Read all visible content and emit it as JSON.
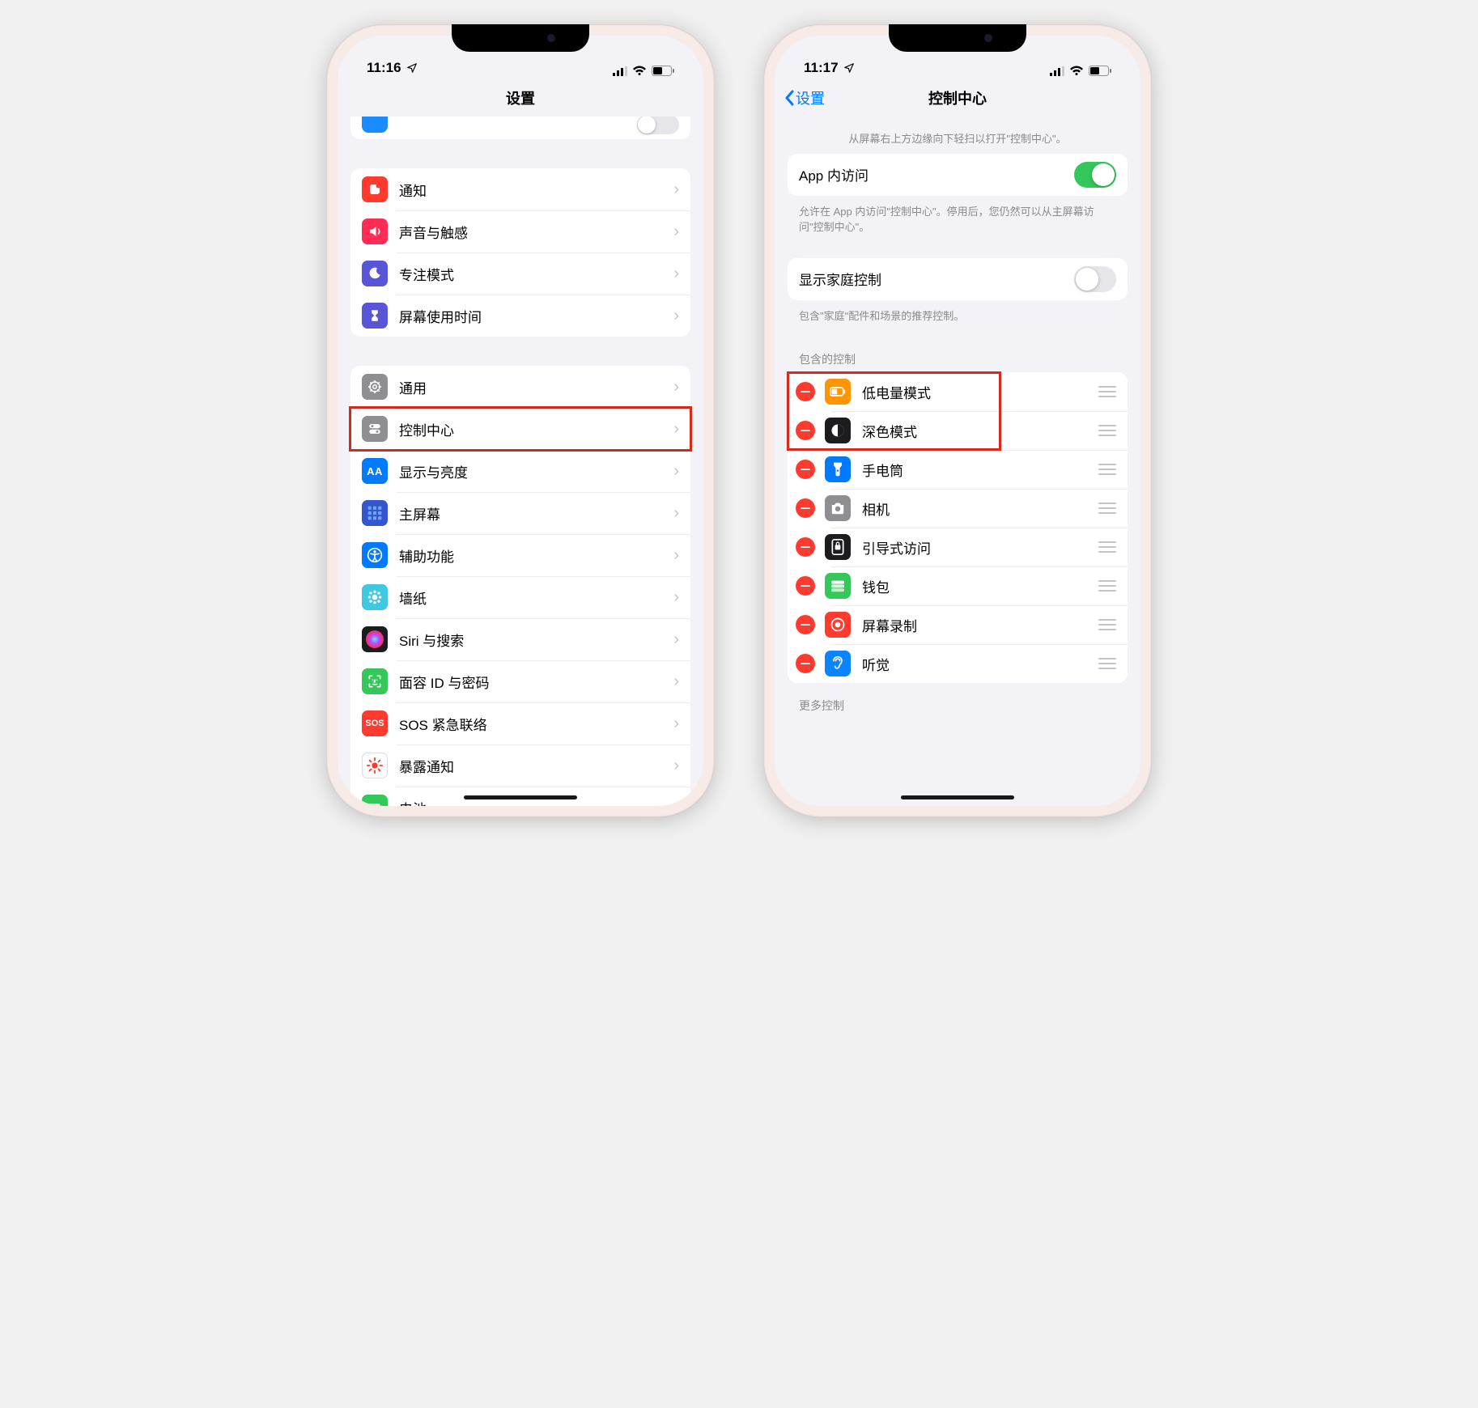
{
  "left": {
    "status": {
      "time": "11:16"
    },
    "nav": {
      "title": "设置"
    },
    "group1": [
      {
        "key": "notifications",
        "label": "通知",
        "bg": "#ff3b30"
      },
      {
        "key": "sounds",
        "label": "声音与触感",
        "bg": "#ff2d55"
      },
      {
        "key": "focus",
        "label": "专注模式",
        "bg": "#5856d6"
      },
      {
        "key": "screentime",
        "label": "屏幕使用时间",
        "bg": "#5856d6"
      }
    ],
    "group2": [
      {
        "key": "general",
        "label": "通用",
        "bg": "#8e8e93"
      },
      {
        "key": "controlcenter",
        "label": "控制中心",
        "bg": "#8e8e93",
        "highlight": true
      },
      {
        "key": "display",
        "label": "显示与亮度",
        "bg": "#007aff"
      },
      {
        "key": "home",
        "label": "主屏幕",
        "bg": "#3355cf"
      },
      {
        "key": "accessibility",
        "label": "辅助功能",
        "bg": "#007aff"
      },
      {
        "key": "wallpaper",
        "label": "墙纸",
        "bg": "#40c8e0"
      },
      {
        "key": "siri",
        "label": "Siri 与搜索",
        "bg": "#1c1c1e"
      },
      {
        "key": "faceid",
        "label": "面容 ID 与密码",
        "bg": "#34c759"
      },
      {
        "key": "sos",
        "label": "SOS 紧急联络",
        "bg": "#ff3b30",
        "text": "SOS"
      },
      {
        "key": "exposure",
        "label": "暴露通知",
        "bg": "#ffffff"
      },
      {
        "key": "battery",
        "label": "电池",
        "bg": "#34c759"
      }
    ]
  },
  "right": {
    "status": {
      "time": "11:17"
    },
    "nav": {
      "back": "设置",
      "title": "控制中心"
    },
    "hint": "从屏幕右上方边缘向下轻扫以打开\"控制中心\"。",
    "access": {
      "label": "App 内访问",
      "on": true,
      "footer": "允许在 App 内访问\"控制中心\"。停用后，您仍然可以从主屏幕访问\"控制中心\"。"
    },
    "home": {
      "label": "显示家庭控制",
      "on": false,
      "footer": "包含\"家庭\"配件和场景的推荐控制。"
    },
    "included_header": "包含的控制",
    "included": [
      {
        "key": "lowpower",
        "label": "低电量模式",
        "bg": "#ff9500",
        "hl": true
      },
      {
        "key": "darkmode",
        "label": "深色模式",
        "bg": "#1c1c1e",
        "hl": true
      },
      {
        "key": "flashlight",
        "label": "手电筒",
        "bg": "#007aff"
      },
      {
        "key": "camera",
        "label": "相机",
        "bg": "#8e8e93"
      },
      {
        "key": "guided",
        "label": "引导式访问",
        "bg": "#1c1c1e"
      },
      {
        "key": "wallet",
        "label": "钱包",
        "bg": "#34c759"
      },
      {
        "key": "screenrec",
        "label": "屏幕录制",
        "bg": "#ff3b30"
      },
      {
        "key": "hearing",
        "label": "听觉",
        "bg": "#0a84ff"
      }
    ],
    "more_header": "更多控制"
  }
}
